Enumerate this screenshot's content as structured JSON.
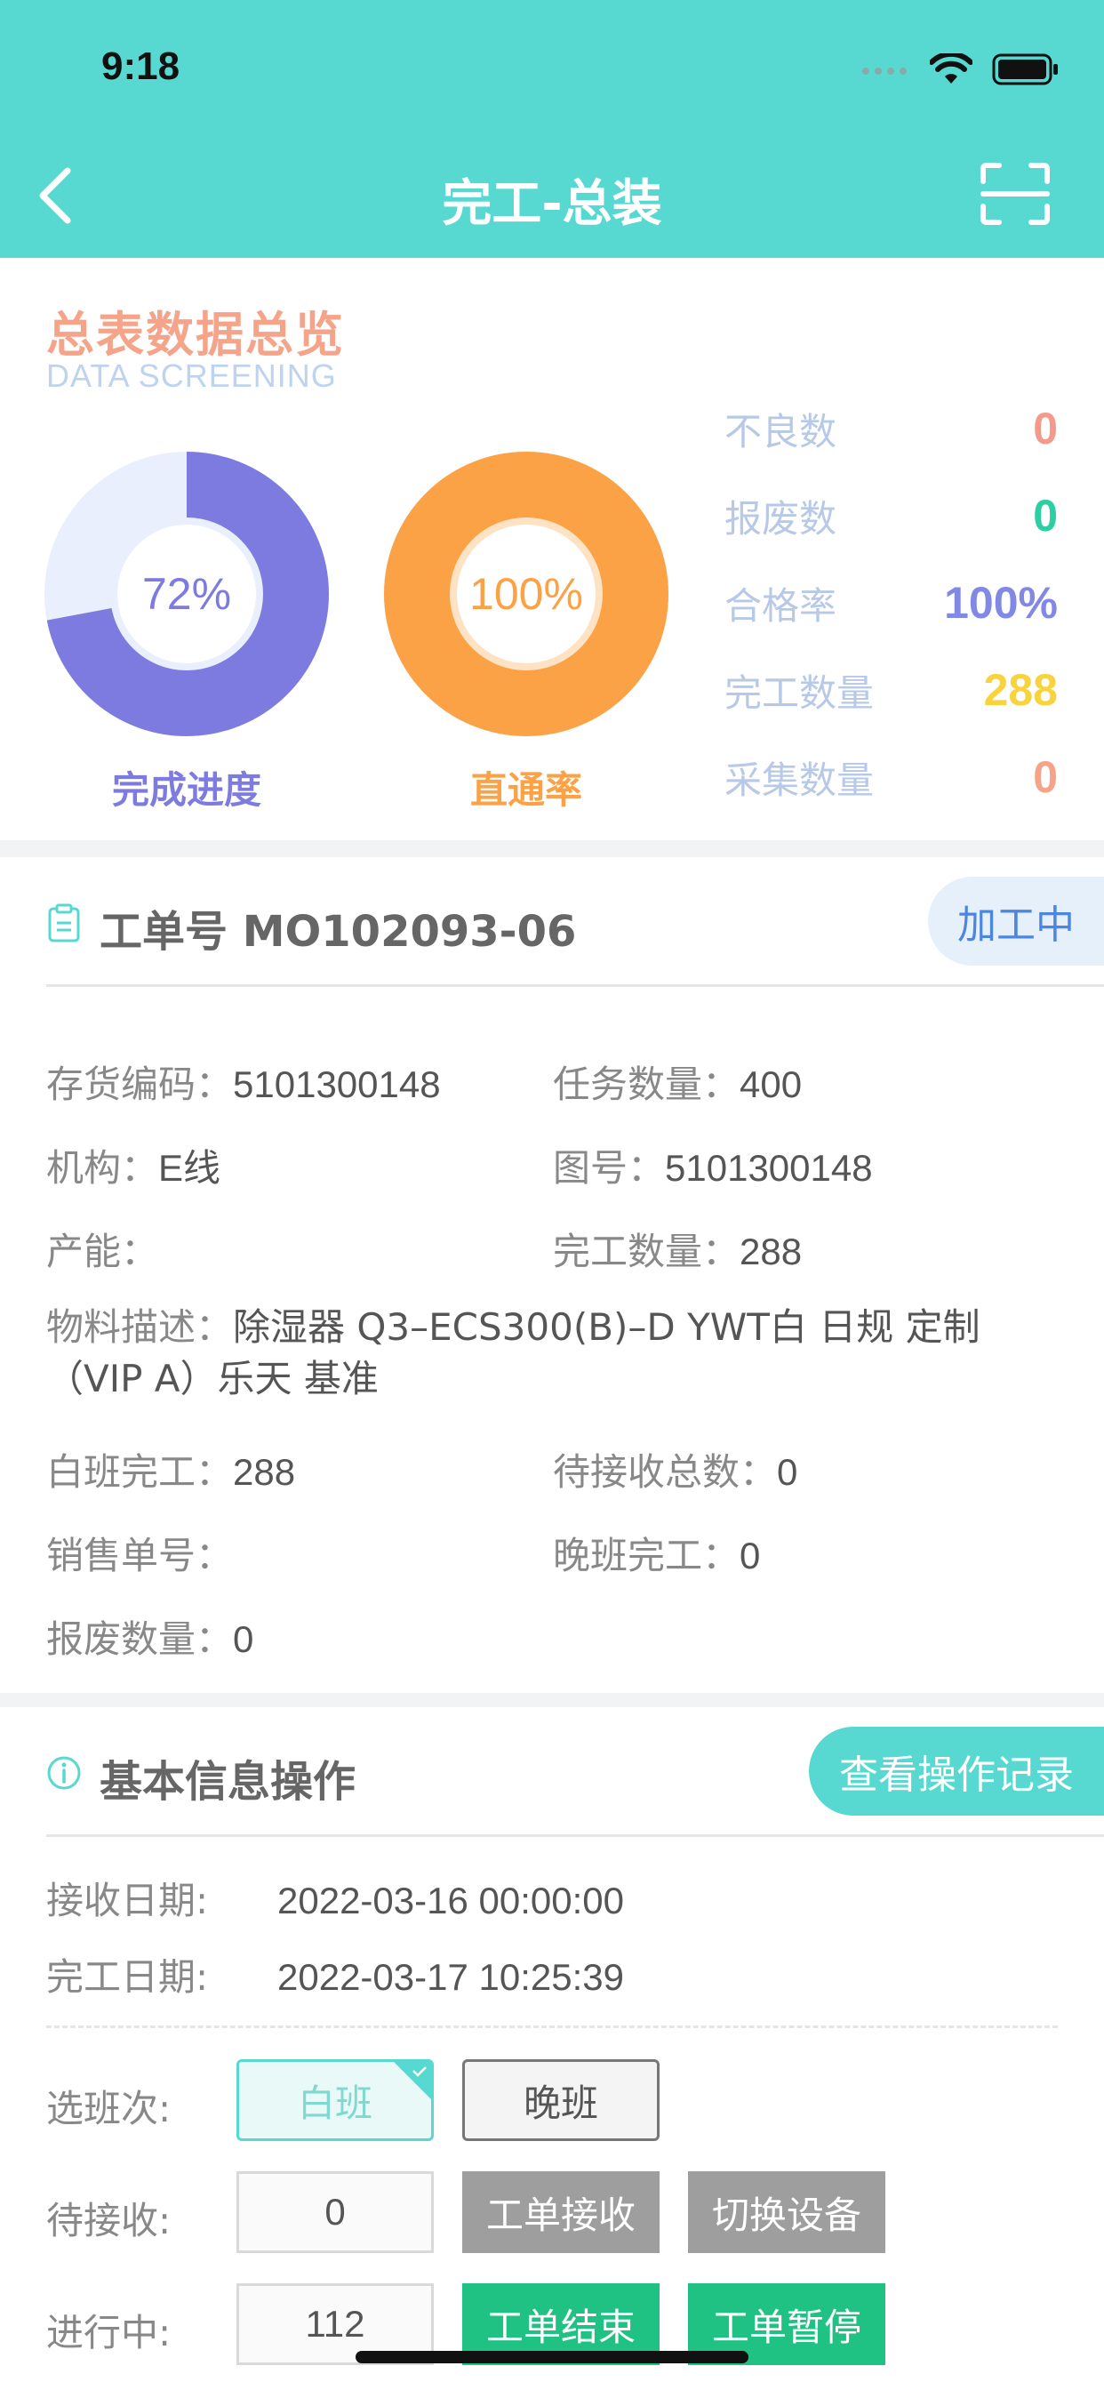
{
  "status": {
    "time": "9:18"
  },
  "nav": {
    "title": "完工-总装"
  },
  "overview": {
    "title": "总表数据总览",
    "subtitle": "DATA SCREENING",
    "rings": [
      {
        "percent_label": "72%",
        "caption": "完成进度",
        "value": 72,
        "color": "#7e7be0",
        "track_color": "#e9effd"
      },
      {
        "percent_label": "100%",
        "caption": "直通率",
        "value": 100,
        "color": "#fba246",
        "track_color": "#fde3c4"
      }
    ],
    "stats": [
      {
        "label": "不良数",
        "value": "0",
        "color": "#f39b8b"
      },
      {
        "label": "报废数",
        "value": "0",
        "color": "#2ccfa4"
      },
      {
        "label": "合格率",
        "value": "100%",
        "color": "#8188e6"
      },
      {
        "label": "完工数量",
        "value": "288",
        "color": "#f8d33e"
      },
      {
        "label": "采集数量",
        "value": "0",
        "color": "#f5a48a"
      }
    ]
  },
  "work_order": {
    "title": "工单号 MO102093-06",
    "status_badge": "加工中",
    "fields": {
      "inventory_code_label": "存货编码：",
      "inventory_code": "5101300148",
      "task_qty_label": "任务数量：",
      "task_qty": "400",
      "org_label": "机构：",
      "org": "E线",
      "drawing_no_label": "图号：",
      "drawing_no": "5101300148",
      "capacity_label": "产能：",
      "capacity": "",
      "done_qty_label": "完工数量：",
      "done_qty": "288",
      "material_desc_label": "物料描述：",
      "material_desc": "除湿器 Q3–ECS300(B)–D YWT白 日规 定制（VIP A）乐天 基准",
      "day_done_label": "白班完工：",
      "day_done": "288",
      "pending_total_label": "待接收总数：",
      "pending_total": "0",
      "sales_no_label": "销售单号：",
      "sales_no": "",
      "night_done_label": "晚班完工：",
      "night_done": "0",
      "scrap_qty_label": "报废数量：",
      "scrap_qty": "0"
    }
  },
  "basic_ops": {
    "title": "基本信息操作",
    "records_button": "查看操作记录",
    "receive_date_label": "接收日期:",
    "receive_date": "2022-03-16 00:00:00",
    "finish_date_label": "完工日期:",
    "finish_date": "2022-03-17 10:25:39",
    "shift_label": "选班次:",
    "shift_day": "白班",
    "shift_night": "晚班",
    "pending_label": "待接收:",
    "pending_value": "0",
    "receive_btn": "工单接收",
    "switch_device_btn": "切换设备",
    "in_progress_label": "进行中:",
    "in_progress_value": "112",
    "finish_btn": "工单结束",
    "pause_btn": "工单暂停"
  }
}
